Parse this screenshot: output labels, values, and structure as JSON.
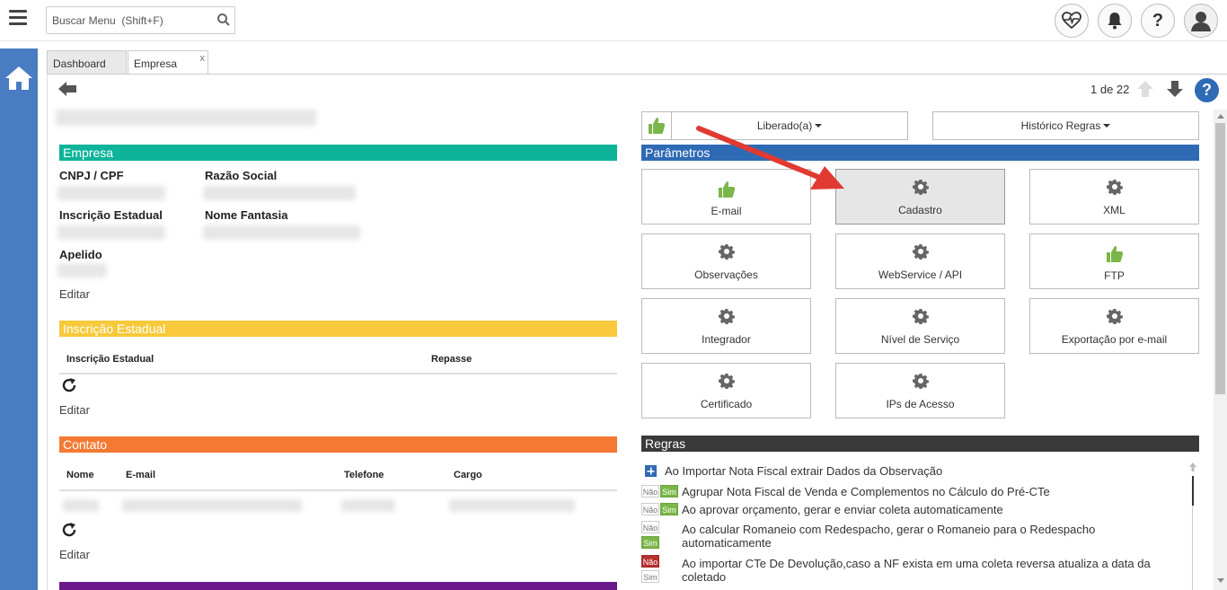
{
  "header": {
    "search_placeholder": "Buscar Menu  (Shift+F)",
    "icons": [
      "menu-icon",
      "heart-pulse-icon",
      "bell-icon",
      "help-icon",
      "user-icon"
    ]
  },
  "tabs": [
    {
      "label": "Dashboard",
      "active": false
    },
    {
      "label": "Empresa",
      "active": true,
      "close": "x"
    }
  ],
  "toolbar": {
    "pager": "1 de 22"
  },
  "left": {
    "empresa": {
      "title": "Empresa",
      "cnpj_label": "CNPJ / CPF",
      "razao_label": "Razão Social",
      "ie_label": "Inscrição Estadual",
      "fantasia_label": "Nome Fantasia",
      "apelido_label": "Apelido",
      "editar": "Editar"
    },
    "inscricao": {
      "title": "Inscrição Estadual",
      "col_ie": "Inscrição Estadual",
      "col_repasse": "Repasse",
      "editar": "Editar"
    },
    "contato": {
      "title": "Contato",
      "col_nome": "Nome",
      "col_email": "E-mail",
      "col_telefone": "Telefone",
      "col_cargo": "Cargo",
      "editar": "Editar"
    },
    "colors": {
      "empresa": "#0fb39a",
      "inscricao": "#f7c93b",
      "contato": "#f47a33",
      "next": "#6a1a8a"
    }
  },
  "right": {
    "liberado": "Liberado(a)",
    "historico": "Histórico Regras",
    "parametros_title": "Parâmetros",
    "cards": [
      {
        "label": "E-mail",
        "icon": "thumbs-up-icon"
      },
      {
        "label": "Cadastro",
        "icon": "gear-icon",
        "selected": true
      },
      {
        "label": "XML",
        "icon": "gear-icon"
      },
      {
        "label": "Observações",
        "icon": "gear-icon"
      },
      {
        "label": "WebService / API",
        "icon": "gear-icon"
      },
      {
        "label": "FTP",
        "icon": "thumbs-up-icon"
      },
      {
        "label": "Integrador",
        "icon": "gear-icon"
      },
      {
        "label": "Nível de Serviço",
        "icon": "gear-icon"
      },
      {
        "label": "Exportação por e-mail",
        "icon": "gear-icon"
      },
      {
        "label": "Certificado",
        "icon": "gear-icon"
      },
      {
        "label": "IPs de Acesso",
        "icon": "gear-icon"
      }
    ],
    "regras_title": "Regras",
    "regras_add": "Ao Importar Nota Fiscal extrair Dados da Observação",
    "rules": [
      {
        "nao": "Não",
        "sim": "Sim",
        "state": "sim",
        "text": "Agrupar Nota Fiscal de Venda e Complementos no Cálculo do Pré-CTe"
      },
      {
        "nao": "Não",
        "sim": "Sim",
        "state": "sim",
        "text": "Ao aprovar orçamento, gerar e enviar coleta automaticamente"
      },
      {
        "nao": "Não",
        "sim": "Sim",
        "state": "sim",
        "text": "Ao calcular Romaneio com Redespacho, gerar o Romaneio para o Redespacho automaticamente"
      },
      {
        "nao": "Não",
        "sim": "Sim",
        "state": "nao",
        "text": "Ao importar CTe De Devolução,caso a NF exista em uma coleta reversa atualiza a data da coletado"
      }
    ],
    "colors": {
      "parametros": "#2f6ab5",
      "regras": "#3a3a3a",
      "thumb": "#7ab648"
    }
  }
}
